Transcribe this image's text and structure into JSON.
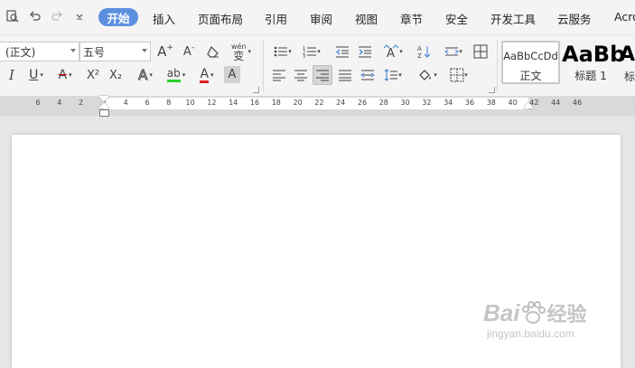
{
  "menubar": {
    "tabs": [
      "开始",
      "插入",
      "页面布局",
      "引用",
      "审阅",
      "视图",
      "章节",
      "安全",
      "开发工具",
      "云服务",
      "Acro"
    ]
  },
  "ribbon": {
    "font_name": "(正文)",
    "font_size": "五号",
    "styles": [
      {
        "preview": "AaBbCcDd",
        "name": "正文"
      },
      {
        "preview": "AaBb",
        "name": "标题 1"
      },
      {
        "preview": "A",
        "name": "标"
      }
    ],
    "pinyin_label": "wén",
    "pinyin_char": "变",
    "highlight_label": "ab",
    "font_color_label": "A",
    "char_shading_label": "A",
    "italic_label": "I",
    "underline_label": "U",
    "strike_label": "A",
    "sup_label": "X²",
    "sub_label": "X₂",
    "grow_label": "A",
    "shrink_label": "A",
    "effects_label": "A"
  },
  "ruler": {
    "ticks": [
      "6",
      "4",
      "2",
      "2",
      "4",
      "6",
      "8",
      "10",
      "12",
      "14",
      "16",
      "18",
      "20",
      "22",
      "24",
      "26",
      "28",
      "30",
      "32",
      "34",
      "36",
      "38",
      "40",
      "42",
      "44",
      "46"
    ]
  },
  "watermark": {
    "brand": "Bai",
    "brand_tail": "经验",
    "url": "jingyan.baidu.com"
  },
  "colors": {
    "accent": "#5b8fe0",
    "highlight_underline": "#2bd12b",
    "font_color_underline": "#e02020"
  }
}
